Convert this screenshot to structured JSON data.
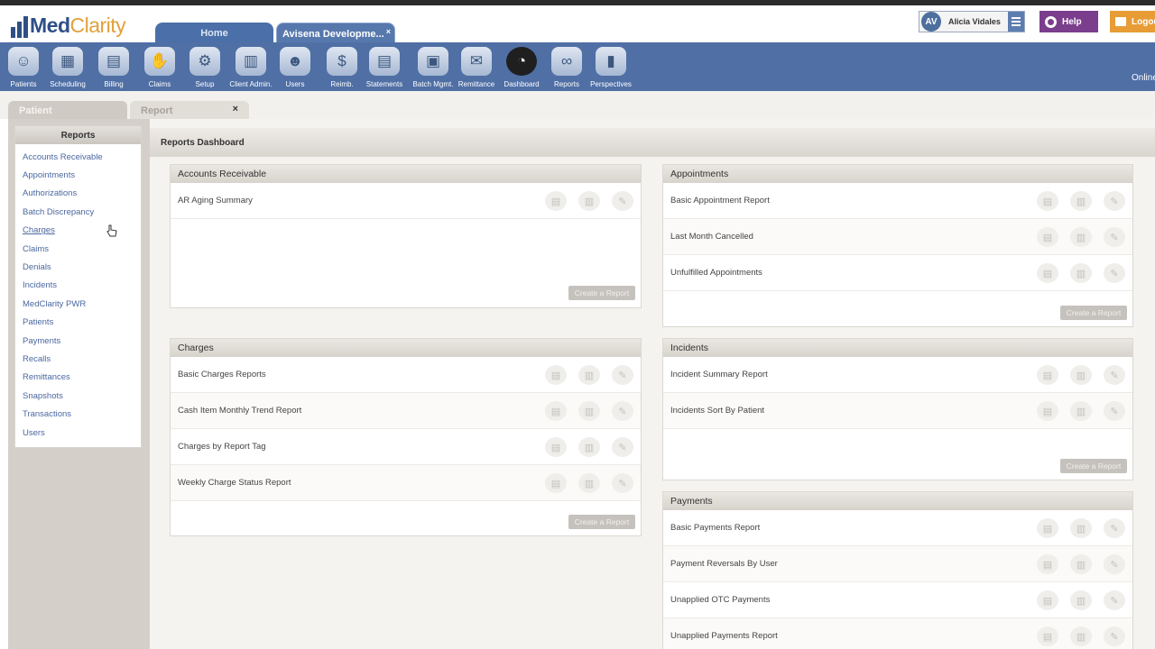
{
  "logo": {
    "part1": "Med",
    "part2": "Clarity"
  },
  "app_tabs": {
    "home": "Home",
    "dev": "Avisena Developme...",
    "close": "×"
  },
  "user": {
    "initials": "AV",
    "name": "Alicia Vidales"
  },
  "help_label": "Help",
  "logout_label": "Logou",
  "toolbar": [
    {
      "label": "Patients",
      "icon": "patient-icon"
    },
    {
      "label": "Scheduling",
      "icon": "calendar-icon"
    },
    {
      "label": "Billing",
      "icon": "billing-icon"
    },
    {
      "label": "Claims",
      "icon": "claims-icon"
    },
    {
      "label": "Setup",
      "icon": "gear-icon"
    },
    {
      "label": "Client Admin.",
      "icon": "client-admin-icon"
    },
    {
      "label": "Users",
      "icon": "users-icon"
    },
    {
      "label": "Reimb.",
      "icon": "reimbursement-icon"
    },
    {
      "label": "Statements",
      "icon": "statements-icon"
    },
    {
      "label": "Batch Mgmt.",
      "icon": "batch-icon"
    },
    {
      "label": "Remittance",
      "icon": "remittance-icon"
    },
    {
      "label": "Dashboard",
      "icon": "dashboard-icon"
    },
    {
      "label": "Reports",
      "icon": "binoculars-icon"
    },
    {
      "label": "Perspectives",
      "icon": "perspectives-icon"
    }
  ],
  "online_text": "Online",
  "subtabs": {
    "patient": "Patient",
    "report": "Report",
    "close": "×"
  },
  "sidebar": {
    "title": "Reports",
    "items": [
      "Accounts Receivable",
      "Appointments",
      "Authorizations",
      "Batch Discrepancy",
      "Charges",
      "Claims",
      "Denials",
      "Incidents",
      "MedClarity PWR",
      "Patients",
      "Payments",
      "Recalls",
      "Remittances",
      "Snapshots",
      "Transactions",
      "Users"
    ]
  },
  "main": {
    "title": "Reports Dashboard",
    "create_label": "Create a Report",
    "panels": {
      "accounts_receivable": {
        "title": "Accounts Receivable",
        "rows": [
          "AR Aging Summary"
        ]
      },
      "charges": {
        "title": "Charges",
        "rows": [
          "Basic Charges Reports",
          "Cash Item Monthly Trend Report",
          "Charges by Report Tag",
          "Weekly Charge Status Report"
        ]
      },
      "appointments": {
        "title": "Appointments",
        "rows": [
          "Basic Appointment Report",
          "Last Month Cancelled",
          "Unfulfilled Appointments"
        ]
      },
      "incidents": {
        "title": "Incidents",
        "rows": [
          "Incident Summary Report",
          "Incidents Sort By Patient"
        ]
      },
      "payments": {
        "title": "Payments",
        "rows": [
          "Basic Payments Report",
          "Payment Reversals By User",
          "Unapplied OTC Payments",
          "Unapplied Payments Report"
        ]
      }
    }
  },
  "colors": {
    "toolbar": "#4f6fa5",
    "brand_blue": "#2e4f86",
    "brand_orange": "#e2a13a",
    "help": "#7b3e8d",
    "logout": "#e79c35"
  }
}
